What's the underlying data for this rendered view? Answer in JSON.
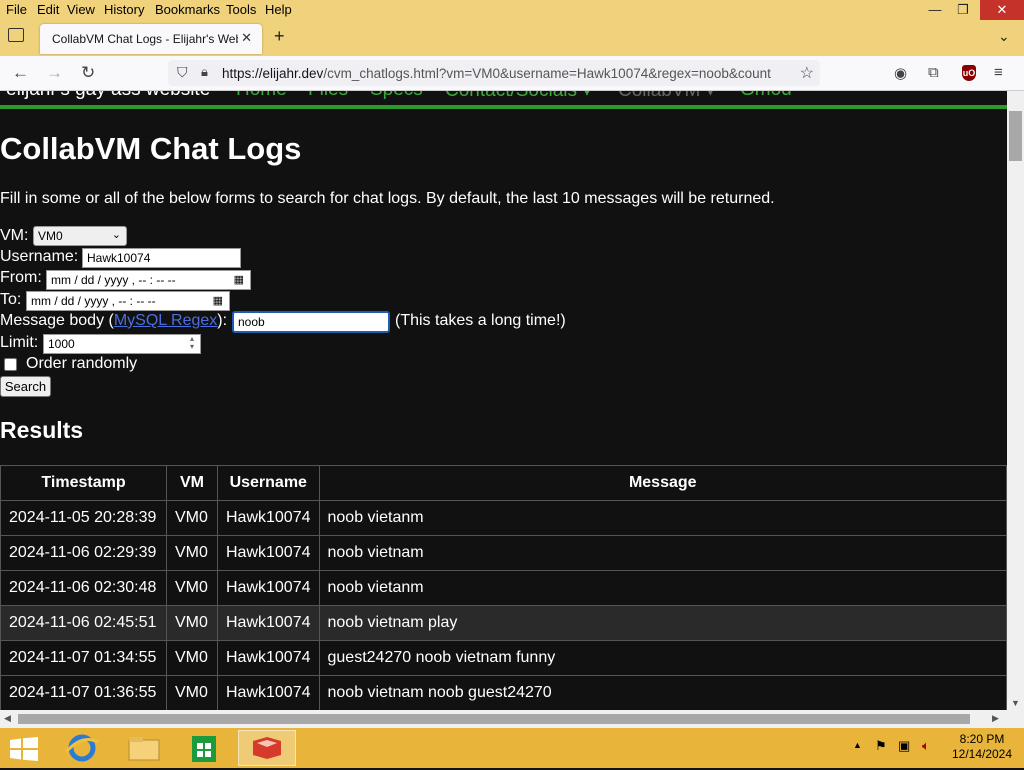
{
  "menubar": {
    "items": [
      "File",
      "Edit",
      "View",
      "History",
      "Bookmarks",
      "Tools",
      "Help"
    ]
  },
  "tab": {
    "title": "CollabVM Chat Logs - Elijahr's Web",
    "close": "✕"
  },
  "urlbar": {
    "host": "https://elijahr.dev",
    "path": "/cvm_chatlogs.html?vm=VM0&username=Hawk10074&regex=noob&count"
  },
  "sitenav": {
    "name": "elijahr's gay ass website",
    "links": [
      "Home",
      "Files",
      "Specs",
      "Contact/Socials ▾",
      "CollabVM ▾",
      "Gmod"
    ]
  },
  "page": {
    "title": "CollabVM Chat Logs",
    "description": "Fill in some or all of the below forms to search for chat logs. By default, the last 10 messages will be returned.",
    "form": {
      "vm_label": "VM:",
      "vm_value": "VM0",
      "username_label": "Username:",
      "username_value": "Hawk10074",
      "from_label": "From:",
      "to_label": "To:",
      "date_placeholder": "mm / dd / yyyy ,  -- : --  --",
      "message_label_pre": "Message body (",
      "message_link": "MySQL Regex",
      "message_label_post": "):",
      "message_value": "noob",
      "message_note": "(This takes a long time!)",
      "limit_label": "Limit:",
      "limit_value": "1000",
      "random_label": "Order randomly",
      "search_label": "Search"
    },
    "results_heading": "Results",
    "table": {
      "headers": [
        "Timestamp",
        "VM",
        "Username",
        "Message"
      ],
      "rows": [
        [
          "2024-11-05 20:28:39",
          "VM0",
          "Hawk10074",
          "noob vietanm"
        ],
        [
          "2024-11-06 02:29:39",
          "VM0",
          "Hawk10074",
          "noob vietnam"
        ],
        [
          "2024-11-06 02:30:48",
          "VM0",
          "Hawk10074",
          "noob vietanm"
        ],
        [
          "2024-11-06 02:45:51",
          "VM0",
          "Hawk10074",
          "noob vietnam play"
        ],
        [
          "2024-11-07 01:34:55",
          "VM0",
          "Hawk10074",
          "guest24270 noob vietnam funny"
        ],
        [
          "2024-11-07 01:36:55",
          "VM0",
          "Hawk10074",
          "noob vietnam noob guest24270"
        ]
      ]
    }
  },
  "taskbar": {
    "time": "8:20 PM",
    "date": "12/14/2024"
  },
  "colors": {
    "accent_green": "#3aab3a",
    "taskbar": "#e8b53a",
    "menubar": "#f0d27c"
  }
}
